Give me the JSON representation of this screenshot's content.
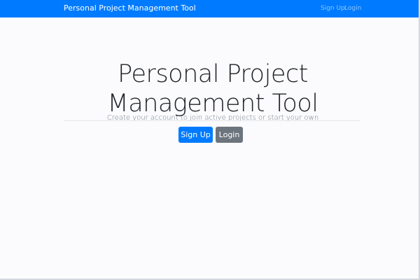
{
  "navbar": {
    "brand": "Personal Project Management Tool",
    "links": [
      {
        "label": "Sign Up"
      },
      {
        "label": "Login"
      }
    ]
  },
  "hero": {
    "title_line1": "Personal Project",
    "title_line2": "Management Tool",
    "lead": "Create your account to join active projects or start your own",
    "signup_label": "Sign Up",
    "login_label": "Login"
  },
  "colors": {
    "primary": "#007bff",
    "secondary": "#6c757d",
    "background": "#fbfbfd"
  }
}
